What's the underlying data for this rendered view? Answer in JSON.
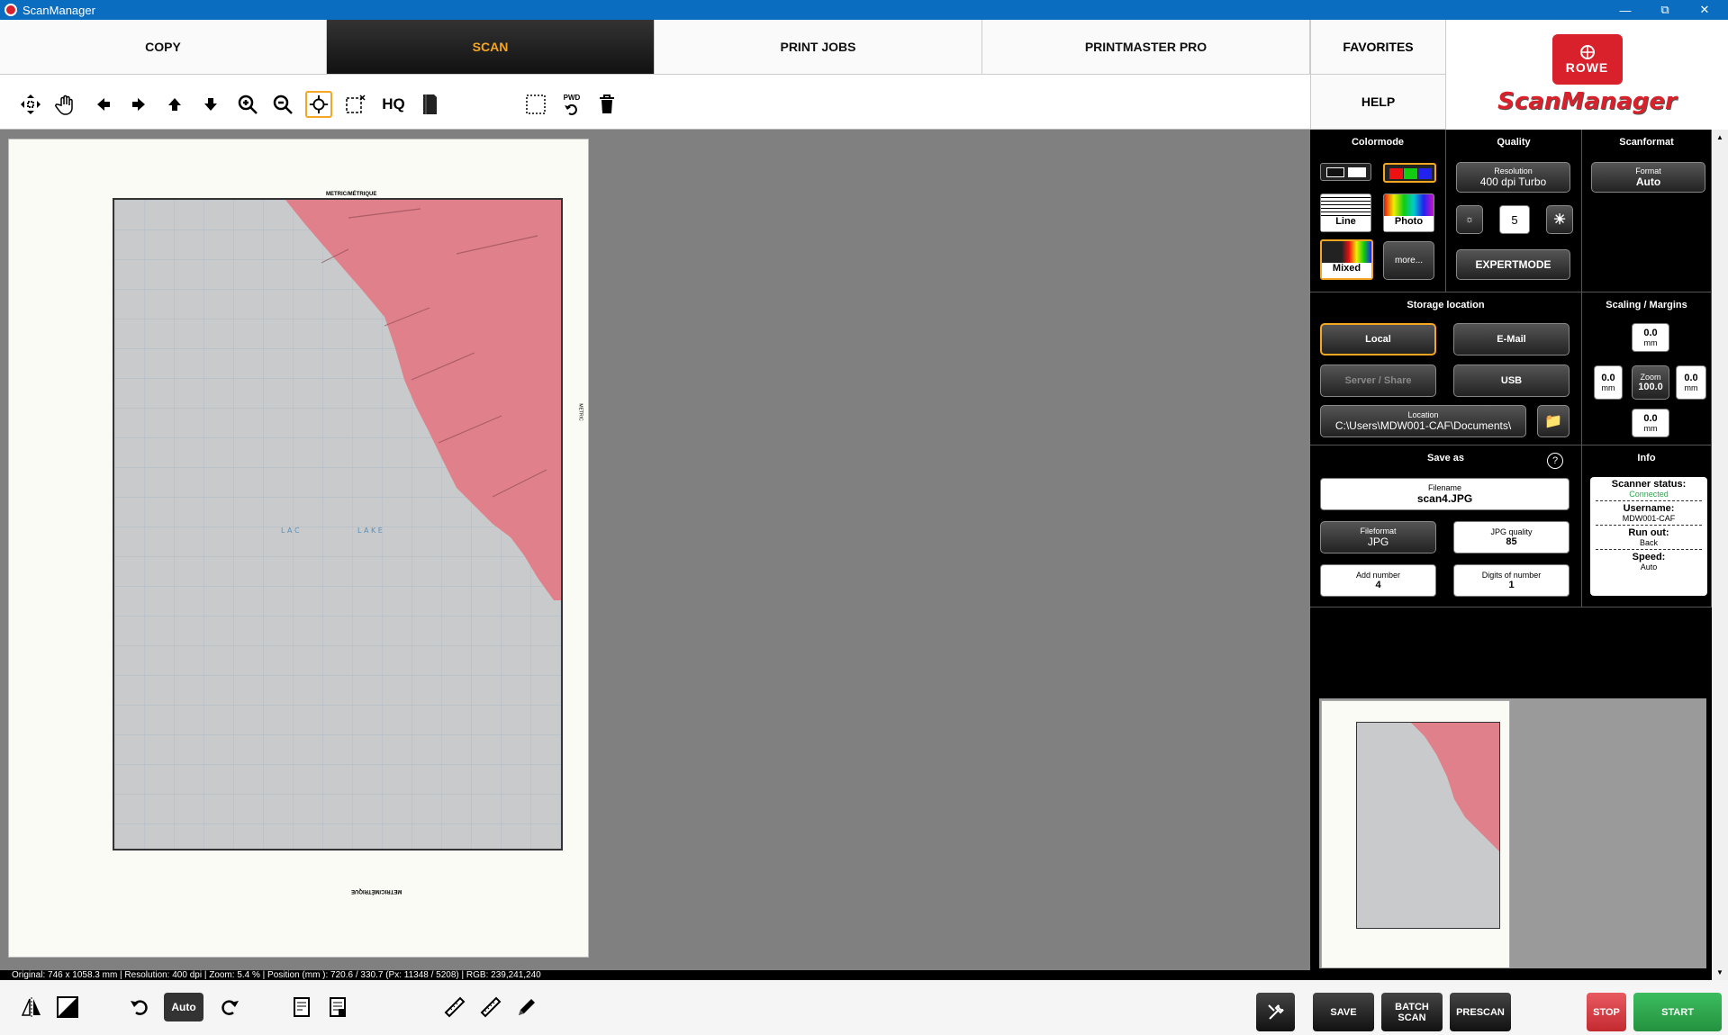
{
  "window": {
    "title": "ScanManager"
  },
  "tabs": {
    "copy": "COPY",
    "scan": "SCAN",
    "print_jobs": "PRINT JOBS",
    "printmaster": "PRINTMASTER PRO",
    "favorites": "FAVORITES",
    "help": "HELP"
  },
  "logo": {
    "badge": "ROWE",
    "wordmark": "ScanManager"
  },
  "toolbar": {
    "hq": "HQ",
    "pwd": "PWD"
  },
  "map": {
    "top_label": "METRIC/MÉTRIQUE",
    "bottom_label": "METRIC/MÉTRIQUE",
    "side_label": "METRIC"
  },
  "colormode": {
    "title": "Colormode",
    "line": "Line",
    "photo": "Photo",
    "mixed": "Mixed",
    "more": "more..."
  },
  "quality": {
    "title": "Quality",
    "resolution_label": "Resolution",
    "resolution_value": "400 dpi Turbo",
    "brightness": "5",
    "expertmode": "EXPERTMODE"
  },
  "scanformat": {
    "title": "Scanformat",
    "format_label": "Format",
    "format_value": "Auto"
  },
  "storage": {
    "title": "Storage location",
    "local": "Local",
    "email": "E-Mail",
    "server": "Server / Share",
    "usb": "USB",
    "location_label": "Location",
    "location_value": "C:\\Users\\MDW001-CAF\\Documents\\"
  },
  "scaling": {
    "title": "Scaling / Margins",
    "top": "0.0",
    "left": "0.0",
    "right": "0.0",
    "bottom": "0.0",
    "unit": "mm",
    "zoom_label": "Zoom",
    "zoom_value": "100.0"
  },
  "save_as": {
    "title": "Save as",
    "help": "?",
    "filename_label": "Filename",
    "filename_value": "scan4.JPG",
    "fileformat_label": "Fileformat",
    "fileformat_value": "JPG",
    "jpg_quality_label": "JPG quality",
    "jpg_quality_value": "85",
    "add_number_label": "Add number",
    "add_number_value": "4",
    "digits_label": "Digits of number",
    "digits_value": "1"
  },
  "info": {
    "title": "Info",
    "scanner_status_label": "Scanner status:",
    "scanner_status_value": "Connected",
    "username_label": "Username:",
    "username_value": "MDW001-CAF",
    "runout_label": "Run out:",
    "runout_value": "Back",
    "speed_label": "Speed:",
    "speed_value": "Auto"
  },
  "status": "Original: 746 x 1058.3 mm  |  Resolution: 400 dpi  |  Zoom: 5.4 %  |  Position (mm ): 720.6 / 330.7 (Px: 11348 / 5208)  |  RGB: 239,241,240",
  "bottom": {
    "auto": "Auto",
    "save": "SAVE",
    "batch_scan": "BATCH SCAN",
    "prescan": "PRESCAN",
    "stop": "STOP",
    "start": "START"
  },
  "colors": {
    "accent": "#f5a623",
    "brand": "#d8212b",
    "start": "#2ea44f",
    "stop": "#d9363e",
    "status_connected": "#2ea44f"
  }
}
